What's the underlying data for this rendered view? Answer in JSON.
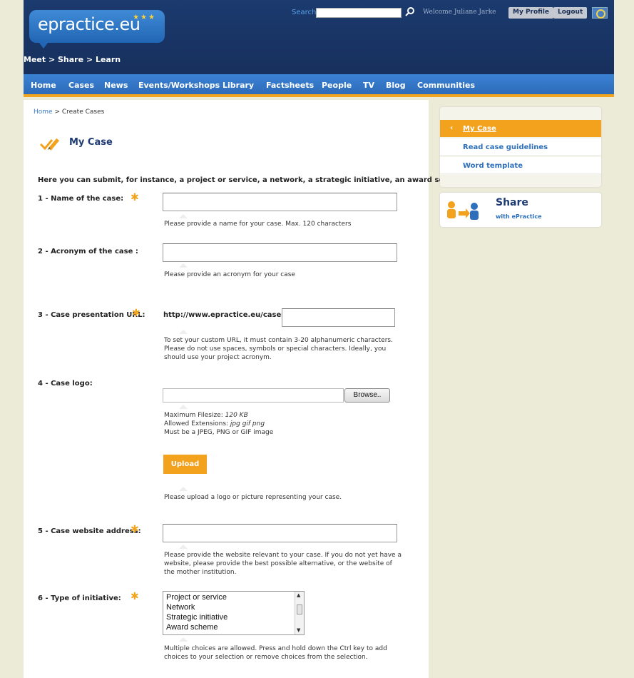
{
  "header": {
    "logo": "epractice.eu",
    "tagline": "Meet > Share > Learn",
    "search_label": "Search",
    "welcome": "Welcome Juliane Jarke",
    "my_profile": "My Profile",
    "logout": "Logout"
  },
  "nav": [
    "Home",
    "Cases",
    "News",
    "Events/Workshops",
    "Library",
    "Factsheets",
    "People",
    "TV",
    "Blog",
    "Communities"
  ],
  "breadcrumb": {
    "home": "Home",
    "sep": " > ",
    "current": "Create Cases"
  },
  "page": {
    "title": "My Case",
    "intro": "Here you can submit, for instance, a project or service, a network, a strategic initiative, an award scheme."
  },
  "fields": {
    "name": {
      "label": "1 - Name of the case:",
      "help": "Please provide a name for your case. Max. 120 characters"
    },
    "acronym": {
      "label": "2 - Acronym of the case :",
      "help": "Please provide an acronym for your case"
    },
    "url": {
      "label": "3 - Case presentation URL:",
      "prefix": "http://www.epractice.eu/cases/",
      "help1": "To set your custom URL, it must contain 3-20 alphanumeric characters.",
      "help2": "Please do not use spaces, symbols or special characters. Ideally, you",
      "help3": "should use your project acronym."
    },
    "logo": {
      "label": "4 - Case logo:",
      "browse": "Browse..",
      "max_size": "Maximum Filesize: ",
      "max_size_val": "120 KB",
      "ext": "Allowed Extensions: ",
      "ext_val": "jpg gif png",
      "must": "Must be a JPEG, PNG or GIF image",
      "upload": "Upload",
      "help": "Please upload a logo or picture representing your case."
    },
    "website": {
      "label": "5 - Case website address:",
      "help1": "Please provide the website relevant to your case. If you do not yet have a",
      "help2": "website, please provide the best possible alternative, or the website of",
      "help3": "the mother institution."
    },
    "type": {
      "label": "6 - Type of initiative:",
      "options": [
        "Project or service",
        "Network",
        "Strategic initiative",
        "Award scheme"
      ],
      "help1": "Multiple choices are allowed. Press and hold down the Ctrl key to add",
      "help2": "choices to your selection or remove choices from the selection."
    }
  },
  "sidebar": {
    "items": [
      "My Case",
      "Read case guidelines",
      "Word template"
    ],
    "share_title": "Share",
    "share_sub": "with ePractice"
  },
  "colors": {
    "accent": "#f3a21e",
    "navy": "#1b3a6e",
    "nav_blue": "#3b82d4",
    "link": "#2e6fbc"
  }
}
